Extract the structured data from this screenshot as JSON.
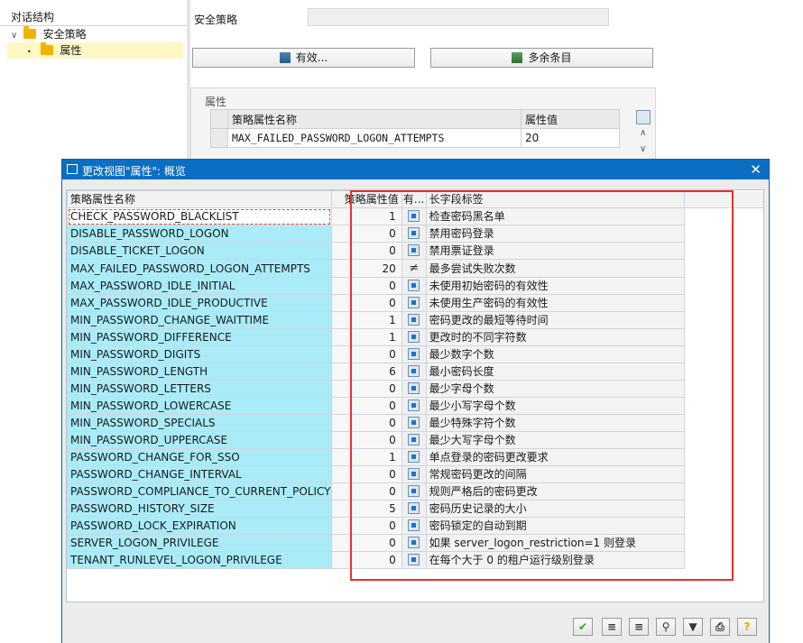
{
  "tree": {
    "header": "对话结构",
    "items": [
      {
        "label": "安全策略"
      },
      {
        "label": "属性"
      }
    ]
  },
  "background": {
    "title_label": "安全策略",
    "buttons": {
      "valid": "有效...",
      "extra": "多余条目"
    },
    "attr_box_title": "属性",
    "table": {
      "headers": [
        "策略属性名称",
        "属性值"
      ],
      "row": [
        "MAX_FAILED_PASSWORD_LOGON_ATTEMPTS",
        "20"
      ]
    }
  },
  "dialog": {
    "title": "更改视图\"属性\": 概览",
    "columns": {
      "name": "策略属性名称",
      "value": "策略属性值",
      "flag": "有...",
      "desc": "长字段标签"
    },
    "rows": [
      {
        "name": "CHECK_PASSWORD_BLACKLIST",
        "value": "1",
        "flag": "box",
        "desc": "检查密码黑名单"
      },
      {
        "name": "DISABLE_PASSWORD_LOGON",
        "value": "0",
        "flag": "box",
        "desc": "禁用密码登录"
      },
      {
        "name": "DISABLE_TICKET_LOGON",
        "value": "0",
        "flag": "box",
        "desc": "禁用票证登录"
      },
      {
        "name": "MAX_FAILED_PASSWORD_LOGON_ATTEMPTS",
        "value": "20",
        "flag": "≠",
        "desc": "最多尝试失败次数"
      },
      {
        "name": "MAX_PASSWORD_IDLE_INITIAL",
        "value": "0",
        "flag": "box",
        "desc": "未使用初始密码的有效性"
      },
      {
        "name": "MAX_PASSWORD_IDLE_PRODUCTIVE",
        "value": "0",
        "flag": "box",
        "desc": "未使用生产密码的有效性"
      },
      {
        "name": "MIN_PASSWORD_CHANGE_WAITTIME",
        "value": "1",
        "flag": "box",
        "desc": "密码更改的最短等待时间"
      },
      {
        "name": "MIN_PASSWORD_DIFFERENCE",
        "value": "1",
        "flag": "box",
        "desc": "更改时的不同字符数"
      },
      {
        "name": "MIN_PASSWORD_DIGITS",
        "value": "0",
        "flag": "box",
        "desc": "最少数字个数"
      },
      {
        "name": "MIN_PASSWORD_LENGTH",
        "value": "6",
        "flag": "box",
        "desc": "最小密码长度"
      },
      {
        "name": "MIN_PASSWORD_LETTERS",
        "value": "0",
        "flag": "box",
        "desc": "最少字母个数"
      },
      {
        "name": "MIN_PASSWORD_LOWERCASE",
        "value": "0",
        "flag": "box",
        "desc": "最少小写字母个数"
      },
      {
        "name": "MIN_PASSWORD_SPECIALS",
        "value": "0",
        "flag": "box",
        "desc": "最少特殊字符个数"
      },
      {
        "name": "MIN_PASSWORD_UPPERCASE",
        "value": "0",
        "flag": "box",
        "desc": "最少大写字母个数"
      },
      {
        "name": "PASSWORD_CHANGE_FOR_SSO",
        "value": "1",
        "flag": "box",
        "desc": "单点登录的密码更改要求"
      },
      {
        "name": "PASSWORD_CHANGE_INTERVAL",
        "value": "0",
        "flag": "box",
        "desc": "常规密码更改的间隔"
      },
      {
        "name": "PASSWORD_COMPLIANCE_TO_CURRENT_POLICY",
        "value": "0",
        "flag": "box",
        "desc": "规则严格后的密码更改"
      },
      {
        "name": "PASSWORD_HISTORY_SIZE",
        "value": "5",
        "flag": "box",
        "desc": "密码历史记录的大小"
      },
      {
        "name": "PASSWORD_LOCK_EXPIRATION",
        "value": "0",
        "flag": "box",
        "desc": "密码锁定的自动到期"
      },
      {
        "name": "SERVER_LOGON_PRIVILEGE",
        "value": "0",
        "flag": "box",
        "desc": "如果 server_logon_restriction=1 则登录"
      },
      {
        "name": "TENANT_RUNLEVEL_LOGON_PRIVILEGE",
        "value": "0",
        "flag": "box",
        "desc": "在每个大于 0 的租户运行级别登录"
      }
    ],
    "toolbar": [
      {
        "icon": "confirm-icon",
        "glyph": "✔",
        "color": "#2f9e2f"
      },
      {
        "icon": "sort-ascending-icon",
        "glyph": "≡",
        "color": "#333333"
      },
      {
        "icon": "sort-descending-icon",
        "glyph": "≡",
        "color": "#333333"
      },
      {
        "icon": "find-icon",
        "glyph": "⚲",
        "color": "#333333"
      },
      {
        "icon": "filter-icon",
        "glyph": "▼",
        "color": "#333333"
      },
      {
        "icon": "print-icon",
        "glyph": "⎙",
        "color": "#333333"
      },
      {
        "icon": "help-icon",
        "glyph": "?",
        "color": "#f2a400"
      }
    ]
  },
  "colors": {
    "dialog_title_bar": "#0a6fc2",
    "name_cell": "#a9ecf8",
    "annotation": "#e8312f"
  }
}
